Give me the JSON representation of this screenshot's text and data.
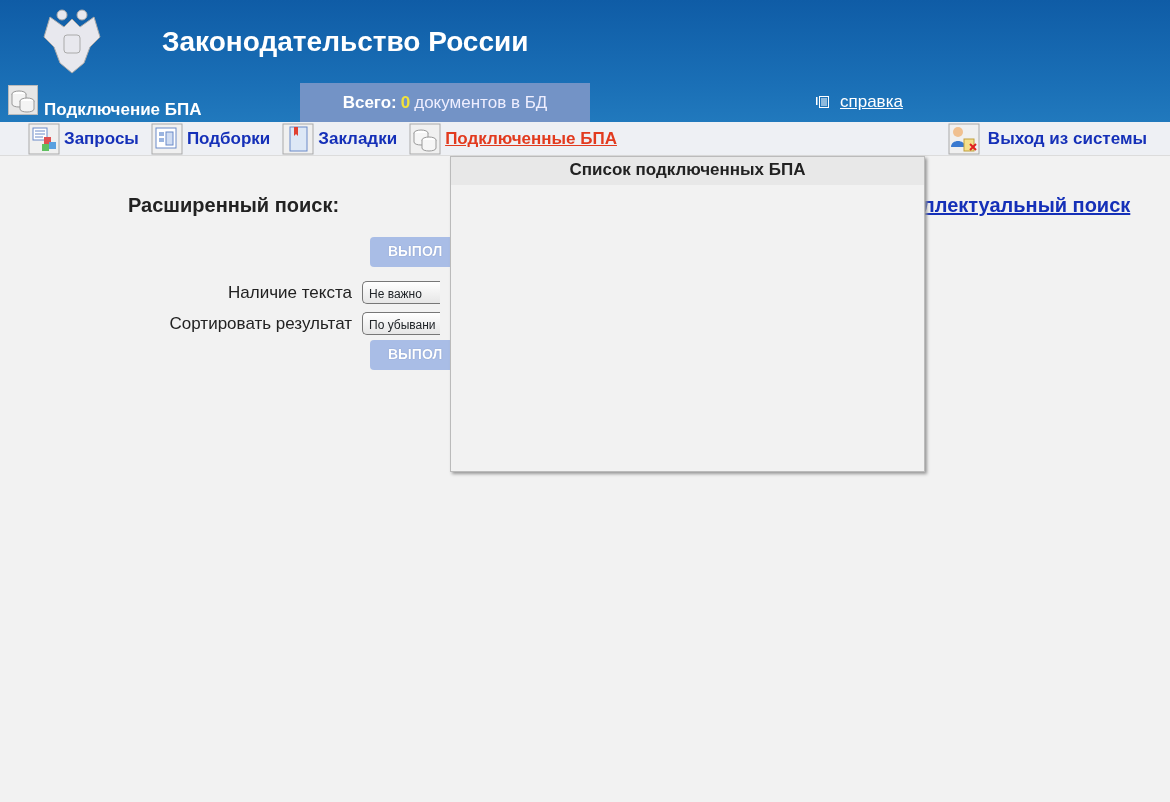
{
  "header": {
    "title": "Законодательство России"
  },
  "subbar": {
    "section": "Подключение БПА",
    "total": {
      "label": "Всего:",
      "count": "0",
      "suffix": "документов в БД"
    },
    "help_link": "справка"
  },
  "nav": {
    "items": [
      {
        "label": "Запросы",
        "kind": "queries",
        "selected": false
      },
      {
        "label": "Подборки",
        "kind": "collections",
        "selected": false
      },
      {
        "label": "Закладки",
        "kind": "bookmarks",
        "selected": false
      },
      {
        "label": "Подключенные БПА",
        "kind": "database",
        "selected": true
      }
    ],
    "logout": "Выход из системы"
  },
  "search": {
    "title": "Расширенный поиск:",
    "link": "ллектуальный поиск",
    "rows": [
      {
        "kind": "button",
        "label": "ВЫПОЛ",
        "disabled": true
      },
      {
        "kind": "select",
        "label": "Наличие текста",
        "value": "Не важно"
      },
      {
        "kind": "select",
        "label": "Сортировать результат",
        "value": "По убывани"
      },
      {
        "kind": "button",
        "label": "ВЫПОЛ",
        "disabled": true
      }
    ]
  },
  "popup": {
    "title": "Список подключенных БПА"
  }
}
